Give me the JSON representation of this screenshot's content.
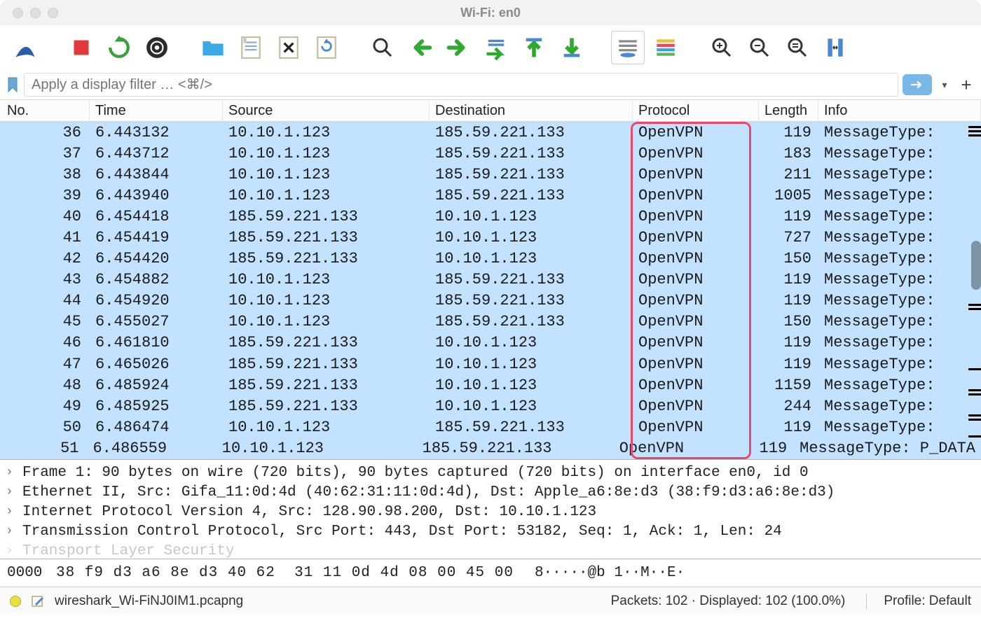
{
  "window": {
    "title": "Wi-Fi: en0"
  },
  "filter": {
    "placeholder": "Apply a display filter … <⌘/>"
  },
  "columns": {
    "no": "No.",
    "time": "Time",
    "source": "Source",
    "destination": "Destination",
    "protocol": "Protocol",
    "length": "Length",
    "info": "Info"
  },
  "packets": [
    {
      "no": "36",
      "time": "6.443132",
      "src": "10.10.1.123",
      "dst": "185.59.221.133",
      "proto": "OpenVPN",
      "len": "119",
      "info": "MessageType:"
    },
    {
      "no": "37",
      "time": "6.443712",
      "src": "10.10.1.123",
      "dst": "185.59.221.133",
      "proto": "OpenVPN",
      "len": "183",
      "info": "MessageType:"
    },
    {
      "no": "38",
      "time": "6.443844",
      "src": "10.10.1.123",
      "dst": "185.59.221.133",
      "proto": "OpenVPN",
      "len": "211",
      "info": "MessageType:"
    },
    {
      "no": "39",
      "time": "6.443940",
      "src": "10.10.1.123",
      "dst": "185.59.221.133",
      "proto": "OpenVPN",
      "len": "1005",
      "info": "MessageType:"
    },
    {
      "no": "40",
      "time": "6.454418",
      "src": "185.59.221.133",
      "dst": "10.10.1.123",
      "proto": "OpenVPN",
      "len": "119",
      "info": "MessageType:"
    },
    {
      "no": "41",
      "time": "6.454419",
      "src": "185.59.221.133",
      "dst": "10.10.1.123",
      "proto": "OpenVPN",
      "len": "727",
      "info": "MessageType:"
    },
    {
      "no": "42",
      "time": "6.454420",
      "src": "185.59.221.133",
      "dst": "10.10.1.123",
      "proto": "OpenVPN",
      "len": "150",
      "info": "MessageType:"
    },
    {
      "no": "43",
      "time": "6.454882",
      "src": "10.10.1.123",
      "dst": "185.59.221.133",
      "proto": "OpenVPN",
      "len": "119",
      "info": "MessageType:"
    },
    {
      "no": "44",
      "time": "6.454920",
      "src": "10.10.1.123",
      "dst": "185.59.221.133",
      "proto": "OpenVPN",
      "len": "119",
      "info": "MessageType:"
    },
    {
      "no": "45",
      "time": "6.455027",
      "src": "10.10.1.123",
      "dst": "185.59.221.133",
      "proto": "OpenVPN",
      "len": "150",
      "info": "MessageType:"
    },
    {
      "no": "46",
      "time": "6.461810",
      "src": "185.59.221.133",
      "dst": "10.10.1.123",
      "proto": "OpenVPN",
      "len": "119",
      "info": "MessageType:"
    },
    {
      "no": "47",
      "time": "6.465026",
      "src": "185.59.221.133",
      "dst": "10.10.1.123",
      "proto": "OpenVPN",
      "len": "119",
      "info": "MessageType:"
    },
    {
      "no": "48",
      "time": "6.485924",
      "src": "185.59.221.133",
      "dst": "10.10.1.123",
      "proto": "OpenVPN",
      "len": "1159",
      "info": "MessageType:"
    },
    {
      "no": "49",
      "time": "6.485925",
      "src": "185.59.221.133",
      "dst": "10.10.1.123",
      "proto": "OpenVPN",
      "len": "244",
      "info": "MessageType:"
    },
    {
      "no": "50",
      "time": "6.486474",
      "src": "10.10.1.123",
      "dst": "185.59.221.133",
      "proto": "OpenVPN",
      "len": "119",
      "info": "MessageType:"
    },
    {
      "no": "51",
      "time": "6.486559",
      "src": "10.10.1.123",
      "dst": "185.59.221.133",
      "proto": "OpenVPN",
      "len": "119",
      "info": "MessageType: P_DATA"
    }
  ],
  "details": {
    "line1": "Frame 1: 90 bytes on wire (720 bits), 90 bytes captured (720 bits) on interface en0, id 0",
    "line2": "Ethernet II, Src: Gifa_11:0d:4d (40:62:31:11:0d:4d), Dst: Apple_a6:8e:d3 (38:f9:d3:a6:8e:d3)",
    "line3": "Internet Protocol Version 4, Src: 128.90.98.200, Dst: 10.10.1.123",
    "line4": "Transmission Control Protocol, Src Port: 443, Dst Port: 53182, Seq: 1, Ack: 1, Len: 24",
    "line5": "Transport Layer Security"
  },
  "hex": {
    "offset": "0000",
    "bytes1": "38 f9 d3 a6 8e d3 40 62",
    "bytes2": "31 11 0d 4d 08 00 45 00",
    "ascii": "8·····@b 1··M··E·"
  },
  "statusbar": {
    "filename": "wireshark_Wi-FiNJ0IM1.pcapng",
    "packets": "Packets: 102 · Displayed: 102 (100.0%)",
    "profile": "Profile: Default"
  }
}
